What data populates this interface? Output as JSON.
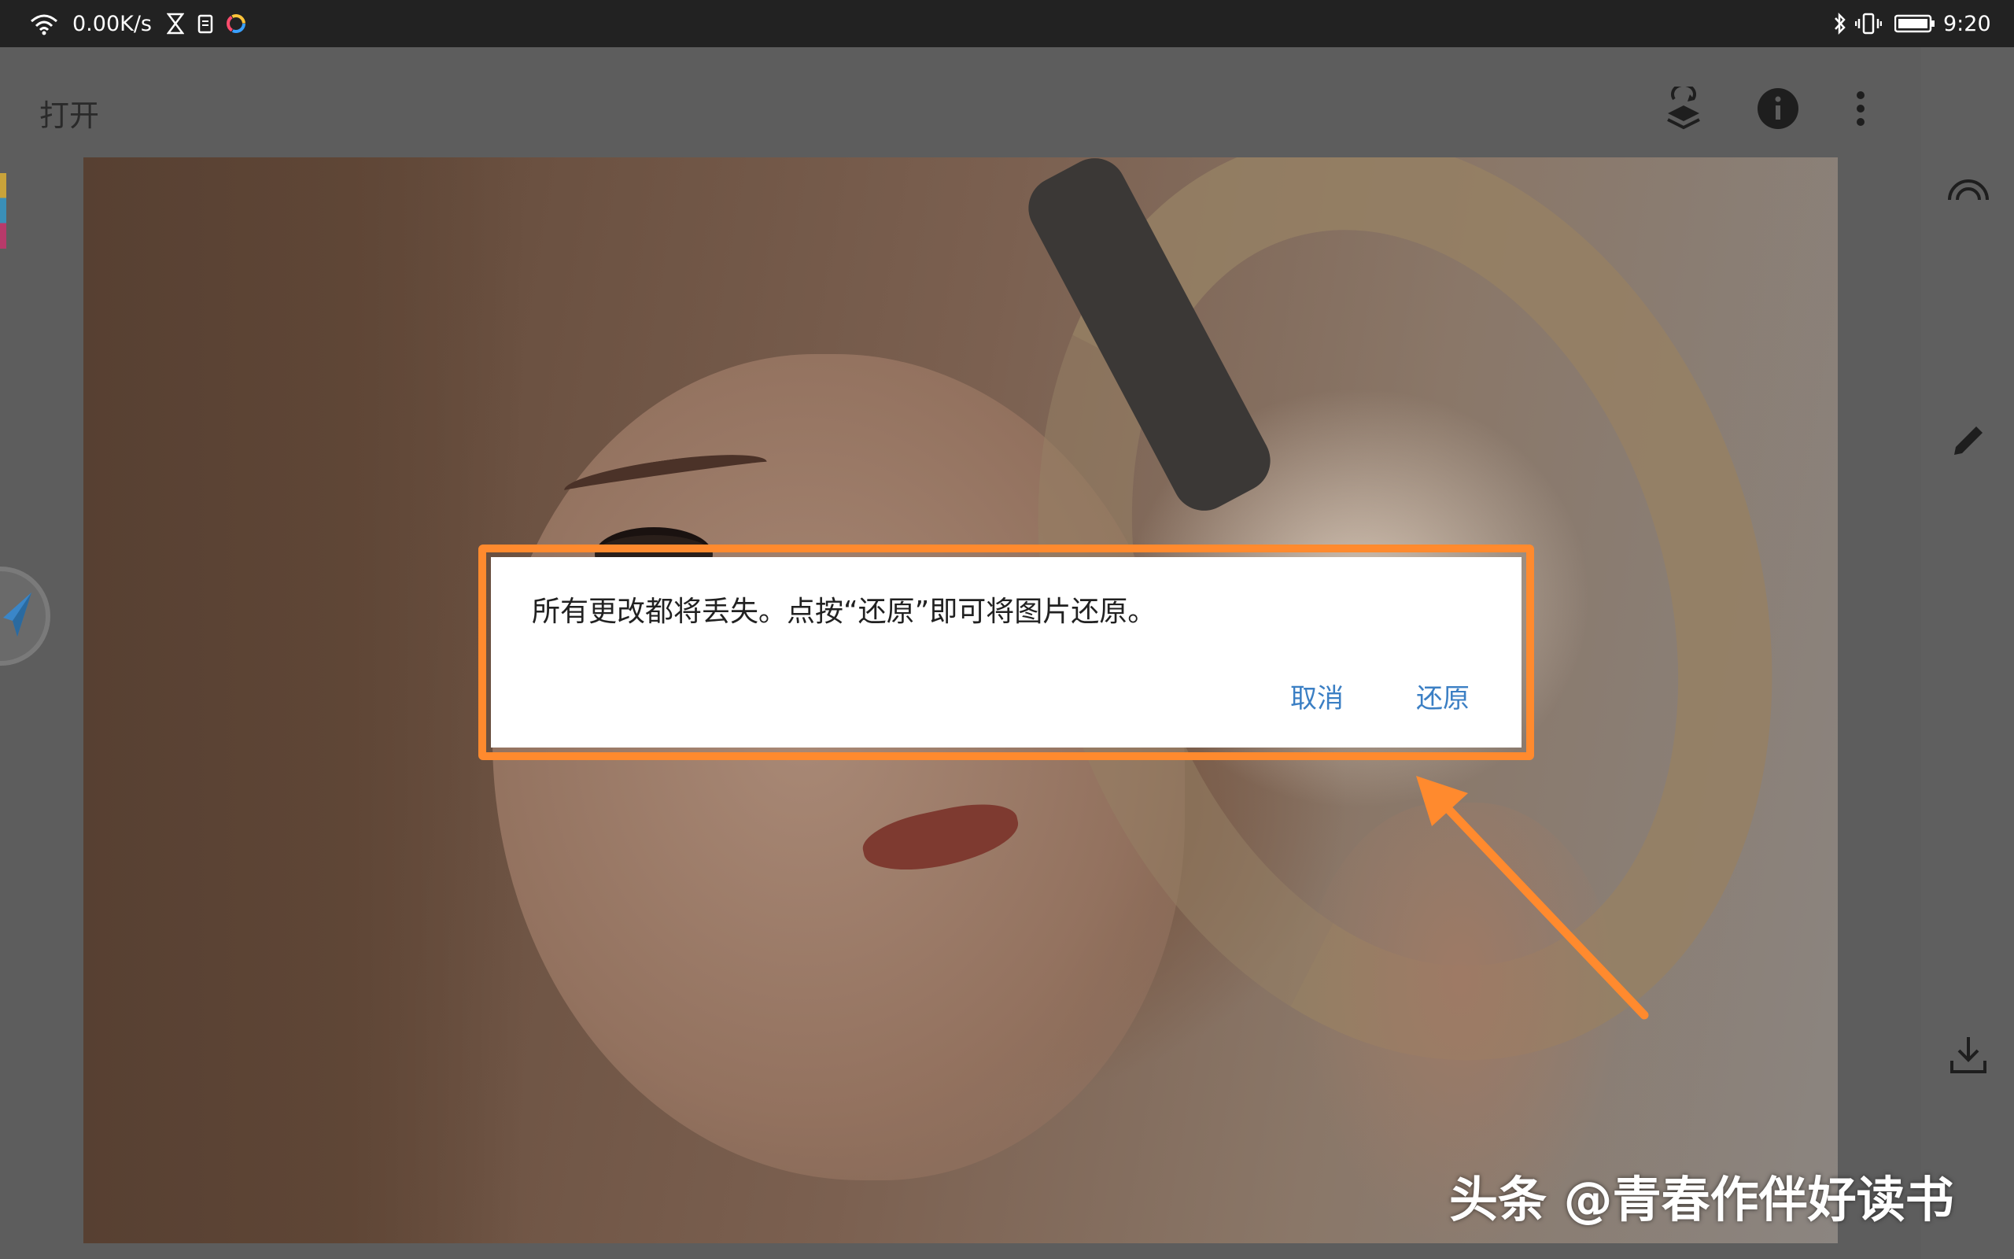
{
  "status_bar": {
    "net_speed": "0.00K/s",
    "clock": "9:20"
  },
  "app": {
    "title": "打开"
  },
  "dialog": {
    "message": "所有更改都将丢失。点按“还原”即可将图片还原。",
    "cancel_label": "取消",
    "restore_label": "还原"
  },
  "watermark": {
    "text": "头条 @青春作伴好读书"
  },
  "colors": {
    "highlight_border": "#ff8a2e",
    "dialog_button": "#3b7fc4",
    "status_bar_bg": "#222222"
  },
  "icons": {
    "top_bar": [
      "layers-reset-icon",
      "info-icon",
      "more-vert-icon"
    ],
    "side_rail": [
      "looks-icon",
      "edit-pencil-icon",
      "download-icon"
    ]
  }
}
